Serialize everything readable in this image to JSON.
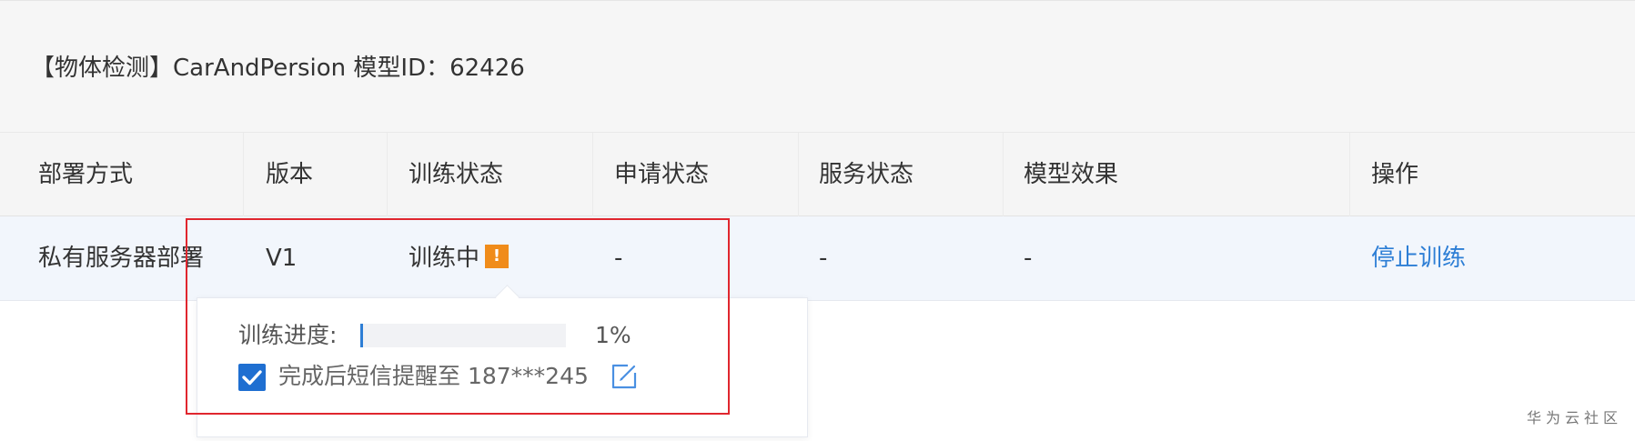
{
  "panel": {
    "title": "【物体检测】CarAndPersion 模型ID：62426"
  },
  "table": {
    "headers": [
      "部署方式",
      "版本",
      "训练状态",
      "申请状态",
      "服务状态",
      "模型效果",
      "操作"
    ],
    "row": {
      "deploy_method": "私有服务器部署",
      "version": "V1",
      "training_status": "训练中",
      "apply_status": "-",
      "service_status": "-",
      "model_effect": "-",
      "action": "停止训练"
    }
  },
  "popover": {
    "progress_label": "训练进度:",
    "progress_percent": "1%",
    "progress_value": 0.01,
    "sms_checkbox_checked": true,
    "sms_label": "完成后短信提醒至 187***245"
  },
  "icons": {
    "warning": "warning-icon",
    "edit": "edit-icon",
    "check": "check-icon"
  },
  "colors": {
    "accent": "#2d7ed5",
    "warning": "#f08c1a",
    "highlight": "#e0262e"
  },
  "watermark": "华为云社区"
}
